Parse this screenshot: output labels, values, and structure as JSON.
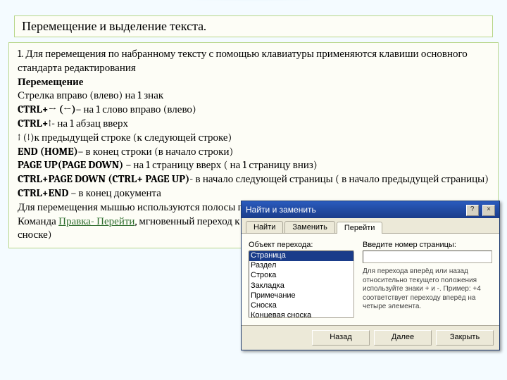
{
  "title": "Перемещение и выделение текста.",
  "content": {
    "intro": "1. Для перемещения по набранному тексту с помощью клавиатуры применяются клавиши основного стандарта редактирования",
    "h_move": "Перемещение",
    "l1": "Стрелка вправо (влево) на 1 знак",
    "l2a": "CTRL+→ (←)",
    "l2b": "– на 1 слово вправо (влево)",
    "l3a": "CTRL+↑",
    "l3b": "- на 1 абзац вверх",
    "l4": "↑ (↓)к предыдущей строке (к следующей строке)",
    "l5a": "END (HOME)",
    "l5b": "– в конец строки (в начало строки)",
    "l6a": "PAGE UP(PAGE DOWN)",
    "l6b": " – на 1 страницу вверх ( на 1 страницу вниз)",
    "l7a": "CTRL+PAGE DOWN (CTRL+ PAGE UP)",
    "l7b": "- в начало следующей страницы ( в начало предыдущей страницы)",
    "l8a": "CTRL+END",
    "l8b": " – в конец документа",
    "l9": "Для перемещения мышью используются полосы прокрутки.",
    "l10a": "Команда ",
    "l10cmd": "Правка- Перейти",
    "l10b": ", мгновенный переход к элементу документа (странице, разделу, строке, сноске)"
  },
  "dialog": {
    "title": "Найти и заменить",
    "tabs": [
      "Найти",
      "Заменить",
      "Перейти"
    ],
    "active_tab": 2,
    "left_label": "Объект перехода:",
    "options": [
      "Страница",
      "Раздел",
      "Строка",
      "Закладка",
      "Примечание",
      "Сноска",
      "Концевая сноска"
    ],
    "selected_index": 0,
    "right_label": "Введите номер страницы:",
    "input_value": "",
    "hint": "Для перехода вперёд или назад относительно текущего положения используйте знаки + и -. Пример: +4 соответствует переходу вперёд на четыре элемента.",
    "buttons": {
      "back": "Назад",
      "next": "Далее",
      "close": "Закрыть"
    }
  }
}
